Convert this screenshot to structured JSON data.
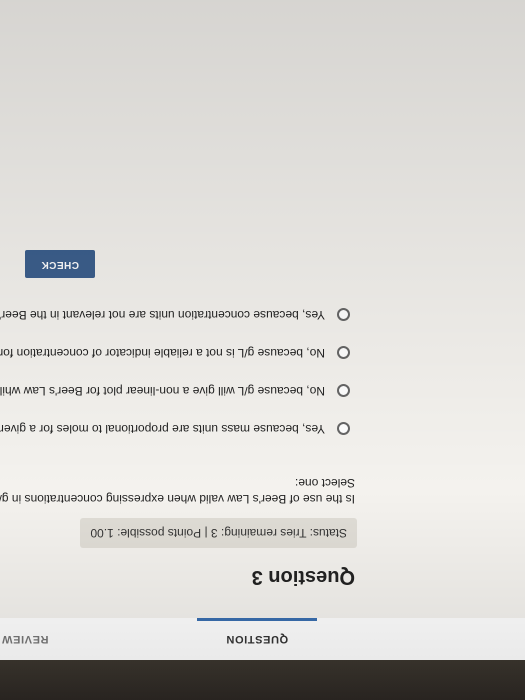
{
  "tabs": {
    "question": "QUESTION",
    "review": "REVIEW"
  },
  "question": {
    "title": "Question 3",
    "status": "Status: Tries remaining: 3 | Points possible: 1.00",
    "prompt": "Is the use of Beer's Law valid when expressing concentrations in g/L rather than M?",
    "select_one": "Select one:",
    "options": [
      "Yes, because mass units are proportional to moles for a given substance.",
      "No, because g/L will give a non-linear plot for Beer's Law while M will give a linear plot.",
      "No, because g/L is not a reliable indicator of concentration for a solution.",
      "Yes, because concentration units are not relevant in the Beer's Law equation."
    ]
  },
  "actions": {
    "check": "CHECK"
  },
  "colors": {
    "accent": "#3c5f8d",
    "tab_underline": "#3a6fb0"
  }
}
